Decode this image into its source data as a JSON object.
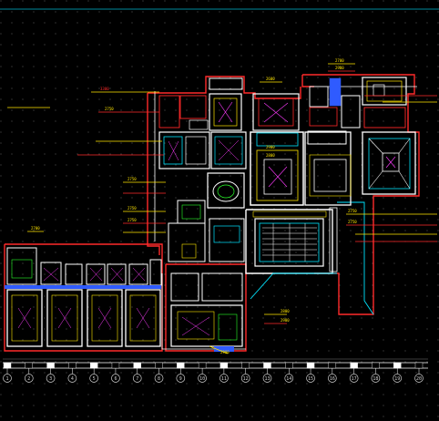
{
  "drawing": {
    "background": "#000000",
    "colors": {
      "wall": "#ff2a2a",
      "outline": "#ffffff",
      "cyan": "#00e5ff",
      "yellow": "#ffe600",
      "magenta": "#ff3cff",
      "green": "#2aff2a",
      "blue": "#2f5bff",
      "grid": "#9a9a9a"
    },
    "dim_labels": {
      "top_a": "2700",
      "top_b": "2900",
      "top_c": "2600",
      "left_a": "3300",
      "left_b": "2750",
      "left_c": "2750",
      "left_d": "2750",
      "left_e": "2750",
      "left_f": "2700",
      "mid_a": "2900",
      "mid_b": "2800",
      "right_a": "2750",
      "right_b": "2750",
      "bottom_a": "2800",
      "bottom_b": "2900",
      "bottom_c": "2900"
    },
    "axis_labels": [
      "1",
      "2",
      "3",
      "4",
      "5",
      "6",
      "7",
      "8",
      "9",
      "10",
      "11",
      "12",
      "13",
      "14",
      "15",
      "16",
      "17",
      "18",
      "19",
      "20"
    ]
  }
}
